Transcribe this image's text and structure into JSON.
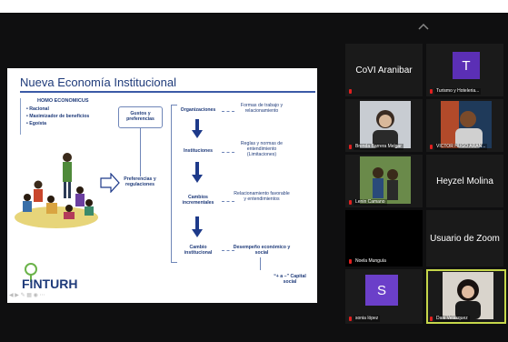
{
  "slide": {
    "title": "Nueva Economía Institucional",
    "homo": {
      "heading": "HOMO ECONOMICUS",
      "items": [
        "Racional",
        "Maximizador de beneficios",
        "Egoísta"
      ]
    },
    "gustos": "Gustos y preferencias",
    "preferencias": "Preferencias y regulaciones",
    "col1": [
      "Organizaciones",
      "Instituciones",
      "Cambios incrementales",
      "Cambio institucional"
    ],
    "col2": [
      "Formas de trabajo y relacionamiento",
      "Reglas y normas de entendimiento (Limitaciones)",
      "Relacionamiento favorable y entendimientos",
      "Desempeño económico y social"
    ],
    "capital": "“+ a –” Capital social",
    "logo_text": "FINTURH"
  },
  "participants": [
    {
      "name_big": "CoVI Aranibar",
      "label": "",
      "type": "name"
    },
    {
      "name_big": "",
      "avatar_letter": "T",
      "avatar_color": "#5b2fb5",
      "label": "Turismo y Hoteleria...",
      "type": "avatar"
    },
    {
      "label": "Brenda Barrera Melgar",
      "type": "photo"
    },
    {
      "label": "VICTOR HUGO ARAN...",
      "type": "photo"
    },
    {
      "label": "Lenin Camano",
      "type": "photo"
    },
    {
      "name_big": "Heyzel Molina",
      "label": "",
      "type": "name"
    },
    {
      "label": "Noela Munguía",
      "type": "dark"
    },
    {
      "name_big": "Usuario de Zoom",
      "label": "",
      "type": "name"
    },
    {
      "avatar_letter": "S",
      "avatar_color": "#6b3fc9",
      "label": "sonia lópez",
      "type": "avatar"
    },
    {
      "label": "Dani Velásquez",
      "type": "photo"
    }
  ],
  "colors": {
    "accent_arrow": "#1e3a8a",
    "active_speaker_border": "#c5d64a",
    "muted_mic": "#e02020"
  }
}
